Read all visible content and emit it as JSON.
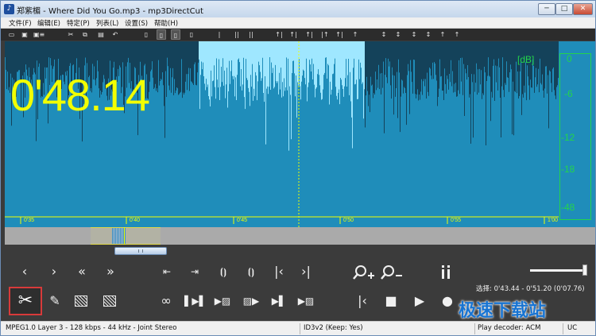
{
  "window": {
    "title": "郑紫楣 - Where Did You Go.mp3 - mp3DirectCut",
    "app_icon": "app-icon",
    "minimize": "─",
    "maximize": "□",
    "close": "✕"
  },
  "menu": [
    "文件(F)",
    "编辑(E)",
    "特定(P)",
    "列表(L)",
    "设置(S)",
    "帮助(H)"
  ],
  "toolbar": {
    "icons": [
      "open-folder-icon",
      "save-icon",
      "save-as-icon",
      "cut-icon",
      "copy-icon",
      "paste-icon",
      "undo-icon",
      "page-icon",
      "page-icon",
      "page-icon",
      "pause-marker-icon",
      "pause-marker-icon",
      "marker-icon",
      "marker-icon",
      "marker-icon",
      "marker-icon",
      "marker-icon",
      "marker-icon",
      "marker-icon",
      "marker-icon",
      "marker-icon",
      "marker-icon",
      "marker-icon",
      "marker-icon",
      "marker-icon",
      "marker-icon",
      "marker-icon",
      "marker-icon",
      "marker-icon"
    ]
  },
  "waveform": {
    "time": "0'48.14",
    "db_unit": "[dB]",
    "db_ticks": [
      "0",
      "-6",
      "-12",
      "-18",
      "-48"
    ],
    "timeline": [
      "0'35",
      "0'40",
      "0'45",
      "0'50",
      "0'55",
      "1'00"
    ],
    "colors": {
      "background": "#1f8dba",
      "wave": "#14425a",
      "selection": "#9fe7ff",
      "text": "#f2ff00",
      "meter": "#23d44b"
    }
  },
  "controls": {
    "row1": [
      "‹",
      "›",
      "«",
      "»",
      "⇤",
      "⇥",
      "⦗⦘",
      "⦗⦘",
      "|‹",
      "›|"
    ],
    "zoom_in": "zoom-in-icon",
    "zoom_out": "zoom-out-icon",
    "info": "info-icon",
    "row2": [
      "cut-icon",
      "pencil-icon",
      "fade-in-icon",
      "fade-out-icon",
      "loop-icon",
      "play-selection-icon",
      "play-marker-icon",
      "prev-marker-icon",
      "next-marker-icon",
      "marker-icon"
    ],
    "transport": [
      "|‹",
      "■",
      "▶",
      "●"
    ],
    "selection": "选择: 0'43.44 - 0'51.20 (0'07.76)",
    "volume_level": 0.92
  },
  "status": {
    "format": "MPEG1.0 Layer 3 - 128 kbps - 44 kHz - Joint Stereo",
    "id3": "ID3v2 (Keep: Yes)",
    "decoder": "Play decoder: ACM",
    "extra": "UC"
  },
  "watermark": "极速下载站"
}
